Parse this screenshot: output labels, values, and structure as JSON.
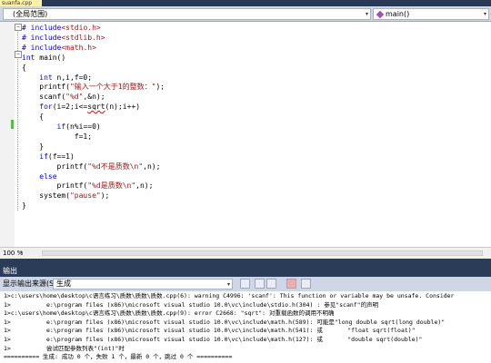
{
  "document_tab": {
    "label": "suanfa.cpp"
  },
  "navigation": {
    "scope": "(全局范围)",
    "member": "main()"
  },
  "code_lines": [
    {
      "segments": [
        {
          "text": "# ",
          "cls": "kw"
        },
        {
          "text": "include",
          "cls": "kw"
        },
        {
          "text": "<stdio.h>",
          "cls": "str"
        }
      ]
    },
    {
      "segments": [
        {
          "text": "# ",
          "cls": "kw"
        },
        {
          "text": "include",
          "cls": "kw"
        },
        {
          "text": "<stdlib.h>",
          "cls": "str"
        }
      ]
    },
    {
      "segments": [
        {
          "text": "# ",
          "cls": "kw"
        },
        {
          "text": "include",
          "cls": "kw"
        },
        {
          "text": "<math.h>",
          "cls": "str"
        }
      ]
    },
    {
      "segments": [
        {
          "text": "int",
          "cls": "kw"
        },
        {
          "text": " main()"
        }
      ]
    },
    {
      "segments": [
        {
          "text": "{"
        }
      ]
    },
    {
      "segments": [
        {
          "text": "    "
        },
        {
          "text": "int",
          "cls": "kw"
        },
        {
          "text": " n,i,f=0;"
        }
      ]
    },
    {
      "segments": [
        {
          "text": "    printf("
        },
        {
          "text": "\"输入一个大于1的整数：\"",
          "cls": "str"
        },
        {
          "text": ");"
        }
      ]
    },
    {
      "segments": [
        {
          "text": "    scanf("
        },
        {
          "text": "\"%d\"",
          "cls": "str"
        },
        {
          "text": ",&n);"
        }
      ]
    },
    {
      "segments": [
        {
          "text": "    "
        },
        {
          "text": "for",
          "cls": "kw"
        },
        {
          "text": "(i=2;i<="
        },
        {
          "text": "sqrt",
          "cls": "sq"
        },
        {
          "text": "(n);i++)"
        }
      ]
    },
    {
      "segments": [
        {
          "text": "    {"
        }
      ]
    },
    {
      "segments": [
        {
          "text": "        "
        },
        {
          "text": "if",
          "cls": "kw"
        },
        {
          "text": "(n%i==0)"
        }
      ]
    },
    {
      "segments": [
        {
          "text": "            f=1;"
        }
      ]
    },
    {
      "segments": [
        {
          "text": "    }"
        }
      ]
    },
    {
      "segments": [
        {
          "text": "    "
        },
        {
          "text": "if",
          "cls": "kw"
        },
        {
          "text": "(f==1)"
        }
      ]
    },
    {
      "segments": [
        {
          "text": "        printf("
        },
        {
          "text": "\"%d不是质数\\n\"",
          "cls": "str"
        },
        {
          "text": ",n);"
        }
      ]
    },
    {
      "segments": [
        {
          "text": "    "
        },
        {
          "text": "else",
          "cls": "kw"
        }
      ]
    },
    {
      "segments": [
        {
          "text": "        printf("
        },
        {
          "text": "\"%d是质数\\n\"",
          "cls": "str"
        },
        {
          "text": ",n);"
        }
      ]
    },
    {
      "segments": [
        {
          "text": "    system("
        },
        {
          "text": "\"pause\"",
          "cls": "str"
        },
        {
          "text": ");"
        }
      ]
    },
    {
      "segments": [
        {
          "text": "}"
        }
      ]
    }
  ],
  "zoom": {
    "level": "100 %"
  },
  "output_panel": {
    "title": "输出",
    "source_label": "显示输出来源(S):",
    "source_value": "生成",
    "lines": [
      "1>c:\\users\\home\\desktop\\c语言练习\\质数\\质数\\质数.cpp(6): warning C4996: 'scanf': This function or variable may be unsafe. Consider",
      "1>          e:\\program files (x86)\\microsoft visual studio 10.0\\vc\\include\\stdio.h(304) : 参见\"scanf\"的声明",
      "1>c:\\users\\home\\desktop\\c语言练习\\质数\\质数\\质数.cpp(9): error C2668: \"sqrt\": 对重载函数的调用不明确",
      "1>          e:\\program files (x86)\\microsoft visual studio 10.0\\vc\\include\\math.h(589): 可能是\"long double sqrt(long double)\"",
      "1>          e:\\program files (x86)\\microsoft visual studio 10.0\\vc\\include\\math.h(541): 或       \"float sqrt(float)\"",
      "1>          e:\\program files (x86)\\microsoft visual studio 10.0\\vc\\include\\math.h(127): 或       \"double sqrt(double)\"",
      "1>          尝试匹配参数列表\"(int)\"时",
      "========== 生成: 成功 0 个，失败 1 个，最新 0 个，跳过 0 个 =========="
    ]
  }
}
